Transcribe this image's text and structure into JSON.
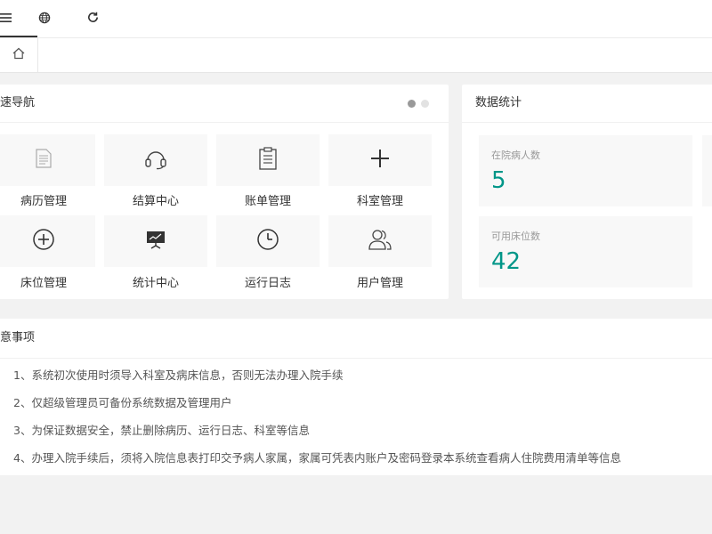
{
  "toolbar": {
    "icons": [
      "menu-icon",
      "globe-icon",
      "refresh-icon"
    ]
  },
  "tabs": {
    "home_icon": "home-icon"
  },
  "quick_nav": {
    "title": "速导航",
    "items": [
      {
        "label": "病历管理",
        "icon": "document-icon"
      },
      {
        "label": "结算中心",
        "icon": "headset-icon"
      },
      {
        "label": "账单管理",
        "icon": "clipboard-icon"
      },
      {
        "label": "科室管理",
        "icon": "plus-icon"
      },
      {
        "label": "床位管理",
        "icon": "plus-circle-icon"
      },
      {
        "label": "统计中心",
        "icon": "presentation-icon"
      },
      {
        "label": "运行日志",
        "icon": "clock-icon"
      },
      {
        "label": "用户管理",
        "icon": "users-icon"
      }
    ]
  },
  "stats": {
    "title": "数据统计",
    "items": [
      {
        "label": "在院病人数",
        "value": "5"
      },
      {
        "label": "可用床位数",
        "value": "42"
      }
    ]
  },
  "notice": {
    "title": "意事项",
    "items": [
      "1、系统初次使用时须导入科室及病床信息，否则无法办理入院手续",
      "2、仅超级管理员可备份系统数据及管理用户",
      "3、为保证数据安全，禁止删除病历、运行日志、科室等信息",
      "4、办理入院手续后，须将入院信息表打印交予病人家属，家属可凭表内账户及密码登录本系统查看病人住院费用清单等信息"
    ]
  },
  "colors": {
    "accent": "#009688",
    "icon": "#444444"
  }
}
